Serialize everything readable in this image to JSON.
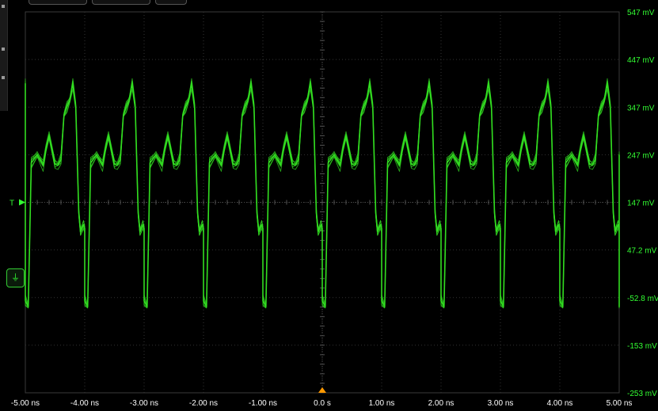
{
  "chart_data": {
    "type": "line",
    "title": "",
    "xlabel": "",
    "ylabel": "",
    "x_ticks": [
      "-5.00 ns",
      "-4.00 ns",
      "-3.00 ns",
      "-2.00 ns",
      "-1.00 ns",
      "0.0 s",
      "1.00 ns",
      "2.00 ns",
      "3.00 ns",
      "4.00 ns",
      "5.00 ns"
    ],
    "y_ticks": [
      "547 mV",
      "447 mV",
      "347 mV",
      "247 mV",
      "147 mV",
      "47.2 mV",
      "-52.8 mV",
      "-153 mV",
      "-253 mV"
    ],
    "xlim_ns": [
      -5,
      5
    ],
    "ylim_mV": [
      -253,
      547
    ],
    "grid": true,
    "legend": "none",
    "trace_color": "#33dd22",
    "trigger_level_mV": 147,
    "trigger_label": "T",
    "trigger_time_ns": 0,
    "period_ns": 1.0,
    "waveform_one_period": {
      "t_offset_ns": [
        0.0,
        0.05,
        0.1,
        0.2,
        0.3,
        0.35,
        0.4,
        0.45,
        0.5,
        0.55,
        0.6,
        0.65,
        0.7,
        0.75,
        0.8,
        0.85,
        0.9,
        0.93,
        0.98,
        1.0
      ],
      "mV": [
        -60,
        -72,
        230,
        247,
        225,
        260,
        287,
        257,
        227,
        225,
        237,
        330,
        347,
        362,
        397,
        347,
        125,
        85,
        100,
        92
      ]
    },
    "overlay_spread_mV": [
      0,
      6,
      -6,
      10,
      -10,
      3
    ]
  },
  "ui": {
    "channel_icon": "ground-channel-icon",
    "trigger_marker_icon": "trigger-position-icon"
  }
}
